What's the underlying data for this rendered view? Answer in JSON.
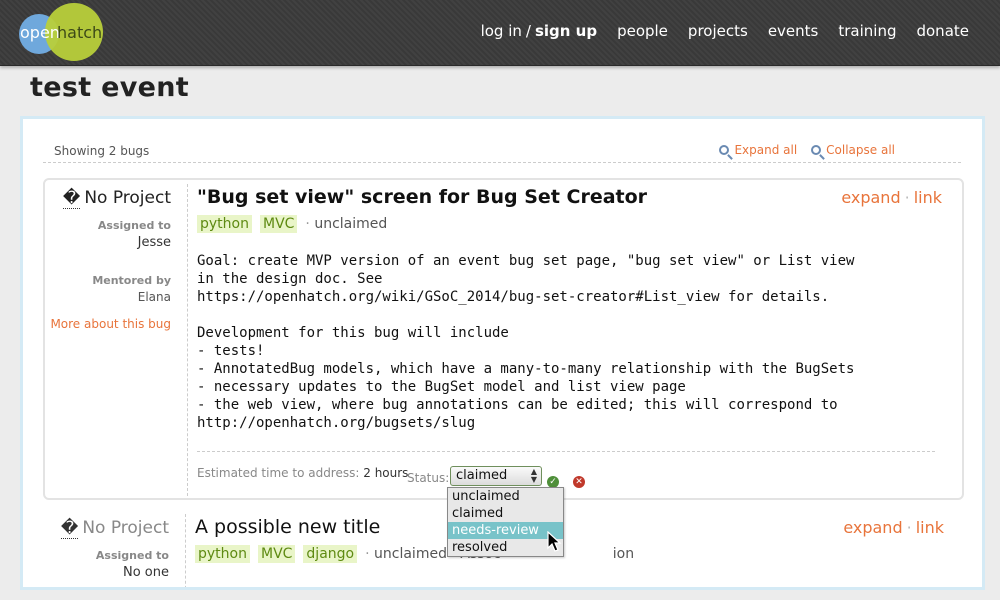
{
  "header": {
    "logo_open": "open",
    "logo_hatch": "hatch",
    "login": "log in",
    "slash": "/",
    "signup": "sign up",
    "nav": [
      "people",
      "projects",
      "events",
      "training",
      "donate"
    ]
  },
  "page": {
    "title": "test event"
  },
  "list": {
    "showing": "Showing 2 bugs",
    "expand_all": "Expand all",
    "collapse_all": "Collapse all"
  },
  "bug1": {
    "project_glyph": "�",
    "project": "No Project",
    "assigned_label": "Assigned to",
    "assigned": "Jesse",
    "mentored_label": "Mentored by",
    "mentor": "Elana",
    "more": "More about this bug",
    "title": "\"Bug set view\" screen for Bug Set Creator",
    "expand": "expand",
    "link": "link",
    "tags": [
      "python",
      "MVC"
    ],
    "sep": "·",
    "state": "unclaimed",
    "description": "Goal: create MVP version of an event bug set page, \"bug set view\" or List view\nin the design doc. See\nhttps://openhatch.org/wiki/GSoC_2014/bug-set-creator#List_view for details.\n\nDevelopment for this bug will include\n- tests!\n- AnnotatedBug models, which have a many-to-many relationship with the BugSets\n- necessary updates to the BugSet model and list view page\n- the web view, where bug annotations can be edited; this will correspond to\nhttp://openhatch.org/bugsets/slug",
    "est_label": "Estimated time to address:",
    "est_value": "2 hours",
    "status_label": "Status:",
    "status_value": "claimed",
    "ok_glyph": "✓",
    "cancel_glyph": "✕"
  },
  "bug2": {
    "project_glyph": "�",
    "project": "No Project",
    "assigned_label": "Assigned to",
    "assigned": "No one",
    "title": "A possible new title",
    "expand": "expand",
    "link": "link",
    "tags": [
      "python",
      "MVC",
      "django"
    ],
    "sep": "·",
    "state": "unclaimed",
    "extra": "Assoc",
    "extra_tail": "ion"
  },
  "status_options": [
    "unclaimed",
    "claimed",
    "needs-review",
    "resolved"
  ],
  "status_highlighted": "needs-review"
}
